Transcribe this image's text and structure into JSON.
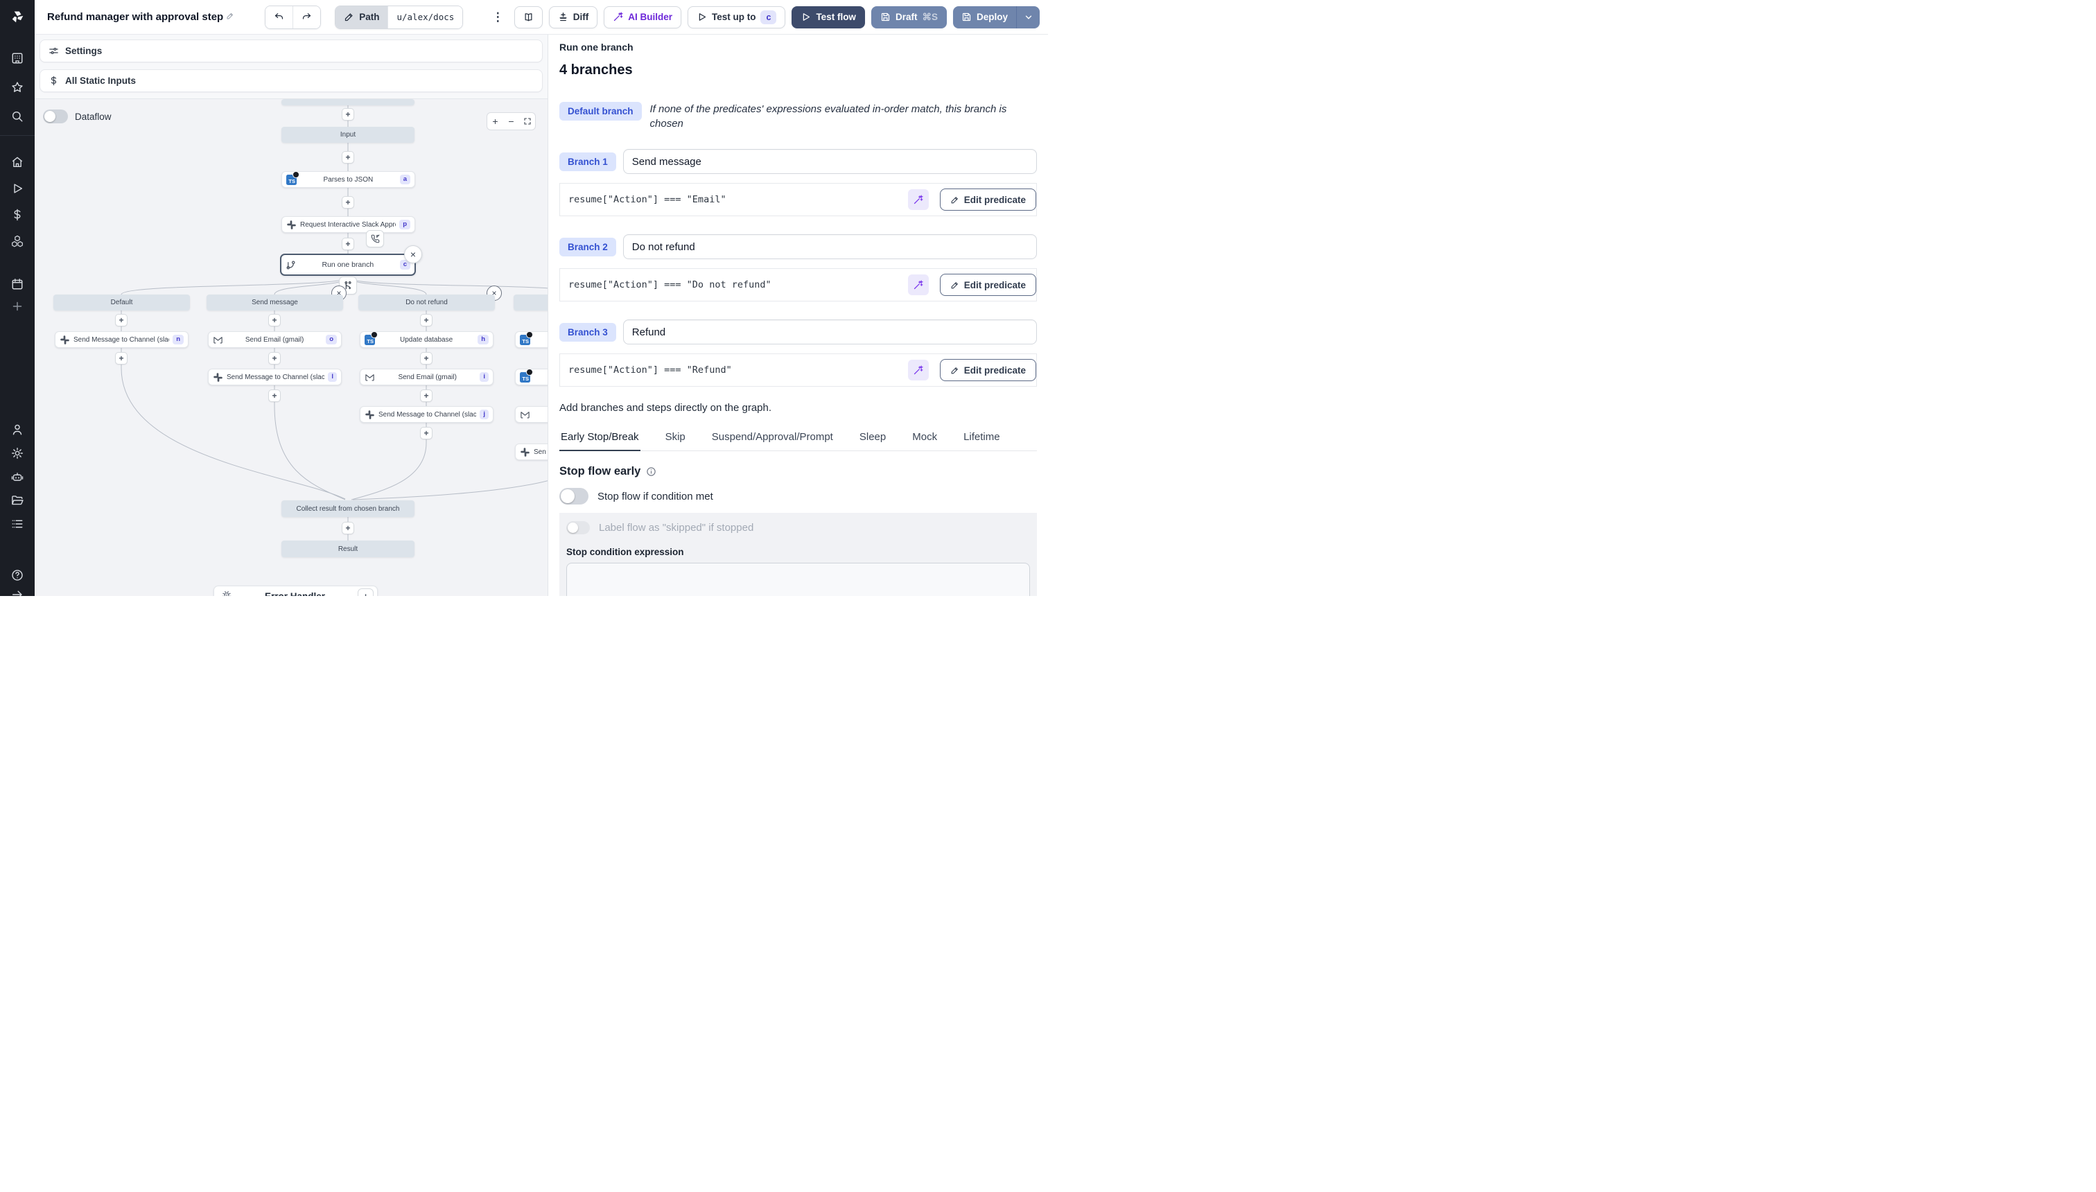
{
  "topbar": {
    "title": "Refund manager with approval step",
    "path_label": "Path",
    "path_value": "u/alex/docs",
    "diff": "Diff",
    "ai_builder": "AI Builder",
    "test_up_to": "Test up to",
    "test_up_to_badge": "c",
    "test_flow": "Test flow",
    "draft": "Draft",
    "draft_shortcut": "⌘S",
    "deploy": "Deploy"
  },
  "sidebar": {
    "icons": [
      "workspace",
      "favorites",
      "search",
      "home",
      "runs",
      "variables",
      "resources",
      "schedules",
      "create",
      "account",
      "settings",
      "ai",
      "folders",
      "logs",
      "help",
      "collapse"
    ]
  },
  "flow": {
    "settings": "Settings",
    "static_inputs": "All Static Inputs",
    "dataflow": "Dataflow",
    "input": "Input",
    "main_steps": [
      {
        "id": "a",
        "label": "Parses to JSON"
      },
      {
        "id": "p",
        "label": "Request Interactive Slack Approval (..."
      },
      {
        "id": "c",
        "label": "Run one branch"
      }
    ],
    "branches": [
      {
        "header": "Default",
        "steps": [
          {
            "id": "n",
            "label": "Send Message to Channel (slack)"
          }
        ]
      },
      {
        "header": "Send message",
        "steps": [
          {
            "id": "o",
            "label": "Send Email (gmail)"
          },
          {
            "id": "l",
            "label": "Send Message to Channel (slack)"
          }
        ]
      },
      {
        "header": "Do not refund",
        "steps": [
          {
            "id": "h",
            "label": "Update database"
          },
          {
            "id": "i",
            "label": "Send Email (gmail)"
          },
          {
            "id": "j",
            "label": "Send Message to Channel (slack)"
          }
        ]
      },
      {
        "header": "",
        "steps": [
          {
            "id": "",
            "label": ""
          },
          {
            "id": "",
            "label": ""
          },
          {
            "id": "",
            "label": ""
          },
          {
            "id": "",
            "label": "Sen"
          }
        ]
      }
    ],
    "collect": "Collect result from chosen branch",
    "result": "Result",
    "error_handler": "Error Handler"
  },
  "panel": {
    "breadcrumb": "Run one branch",
    "heading": "4 branches",
    "default_branch_badge": "Default branch",
    "default_branch_desc": "If none of the predicates' expressions evaluated in-order match, this branch is chosen",
    "branches": [
      {
        "badge": "Branch 1",
        "summary": "Send message",
        "predicate": "resume[\"Action\"] === \"Email\""
      },
      {
        "badge": "Branch 2",
        "summary": "Do not refund",
        "predicate": "resume[\"Action\"] === \"Do not refund\""
      },
      {
        "badge": "Branch 3",
        "summary": "Refund",
        "predicate": "resume[\"Action\"] === \"Refund\""
      }
    ],
    "edit_predicate": "Edit predicate",
    "add_note": "Add branches and steps directly on the graph.",
    "tabs": [
      "Early Stop/Break",
      "Skip",
      "Suspend/Approval/Prompt",
      "Sleep",
      "Mock",
      "Lifetime"
    ],
    "active_tab": "Early Stop/Break",
    "stop_early": {
      "heading": "Stop flow early",
      "condition_toggle": "Stop flow if condition met",
      "skipped_toggle": "Label flow as \"skipped\" if stopped",
      "expression_label": "Stop condition expression"
    }
  },
  "colors": {
    "accent_purple": "#6d28d9",
    "navy_button": "#3d4b6b",
    "slate_button": "#6f85ac",
    "step_badge_bg": "#e3e5fc",
    "step_badge_text": "#4338ca",
    "branch_badge_bg": "#dbe4fd",
    "branch_badge_text": "#3451d1"
  }
}
